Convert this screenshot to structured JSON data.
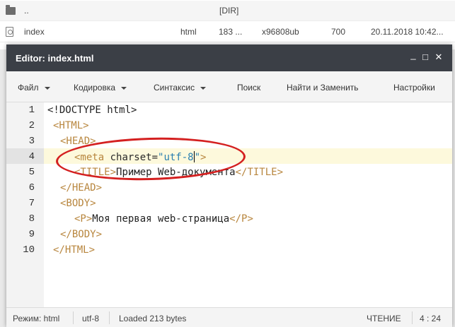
{
  "file_manager": {
    "rows": [
      {
        "icon": "folder-icon",
        "name": "..",
        "type": "[DIR]"
      },
      {
        "icon": "file-icon",
        "name": "index",
        "type": "html",
        "size": "183 ...",
        "owner": "x96808ub",
        "perms": "700",
        "date": "20.11.2018 10:42..."
      }
    ]
  },
  "editor": {
    "title": "Editor: index.html",
    "window_buttons": {
      "minimize": "_",
      "maximize": "□",
      "close": "✕"
    },
    "menu": {
      "file": "Файл",
      "encoding": "Кодировка",
      "syntax": "Синтаксис",
      "search": "Поиск",
      "find_replace": "Найти и Заменить",
      "settings": "Настройки"
    },
    "code": {
      "line_numbers": [
        "1",
        "2",
        "3",
        "4",
        "5",
        "6",
        "7",
        "8",
        "9",
        "10"
      ],
      "lines": {
        "l1": "<!DOCTYPE html>",
        "l2_open": "<HTML>",
        "l3_open": "<HEAD>",
        "l4_tag": "<meta",
        "l4_attr": " charset=",
        "l4_val": "\"utf-8",
        "l4_val_end": "\"",
        "l4_close": ">",
        "l5_open": "<TITLE>",
        "l5_text": "Пример Web-документа",
        "l5_close": "</TITLE>",
        "l6": "</HEAD>",
        "l7": "<BODY>",
        "l8_open": "<P>",
        "l8_text": "Моя первая web-страница",
        "l8_close": "</P>",
        "l9": "</BODY>",
        "l10": "</HTML>"
      }
    },
    "status": {
      "mode": "Режим: html",
      "encoding": "utf-8",
      "loaded": "Loaded 213 bytes",
      "read_mode": "ЧТЕНИЕ",
      "position": "4 : 24"
    }
  }
}
